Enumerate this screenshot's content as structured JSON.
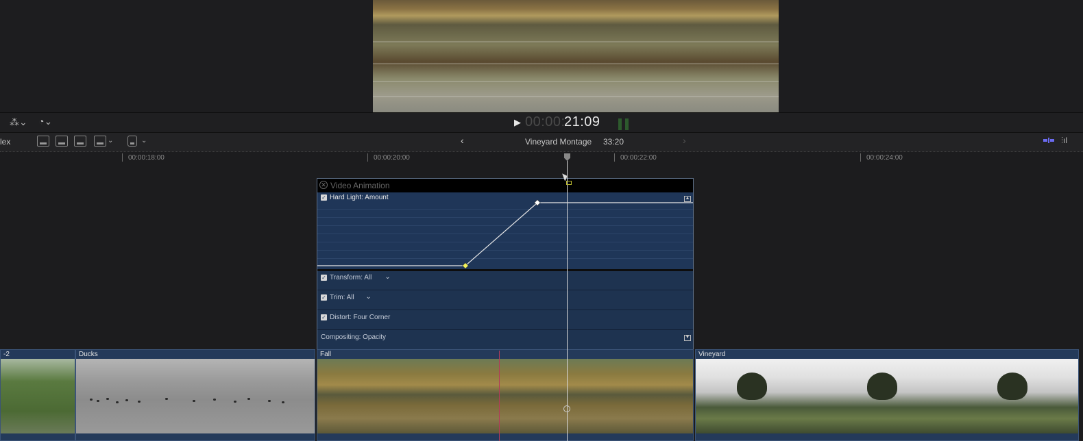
{
  "transport": {
    "play_icon": "▶",
    "timecode_dim": "00:00:",
    "timecode_bright": "21:09"
  },
  "toolbar": {
    "index_label": "lex",
    "back_icon": "‹",
    "forward_icon": "›",
    "project_name": "Vineyard Montage",
    "project_duration": "33:20"
  },
  "ruler": {
    "ticks": [
      "00:00:18:00",
      "00:00:20:00",
      "00:00:22:00",
      "00:00:24:00"
    ]
  },
  "animation_editor": {
    "title": "Video Animation",
    "graph_param": "Hard Light: Amount",
    "params": [
      {
        "label": "Transform: All",
        "has_menu": true,
        "checked": true
      },
      {
        "label": "Trim: All",
        "has_menu": true,
        "checked": true
      },
      {
        "label": "Distort: Four Corner",
        "has_menu": false,
        "checked": true
      },
      {
        "label": "Compositing: Opacity",
        "has_menu": false,
        "checked": false
      }
    ],
    "keyframes": [
      {
        "value": 0,
        "selected": true
      },
      {
        "value": 1,
        "selected": false
      }
    ]
  },
  "clips": [
    {
      "label": "-2"
    },
    {
      "label": "Ducks"
    },
    {
      "label": "Fall"
    },
    {
      "label": "Vineyard"
    }
  ],
  "colors": {
    "clip_blue": "#243a5a",
    "keyframe_selected": "#f2f25a",
    "skimmer": "#b33a5a"
  }
}
